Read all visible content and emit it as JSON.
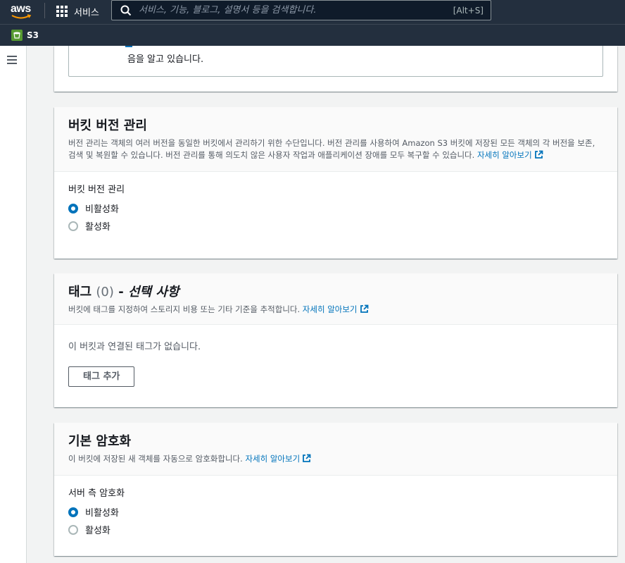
{
  "topnav": {
    "logo_text": "aws",
    "services_label": "서비스",
    "search_placeholder": "서비스, 기능, 블로그, 설명서 등을 검색합니다.",
    "search_shortcut": "[Alt+S]"
  },
  "subnav": {
    "service_label": "S3"
  },
  "top_panel": {
    "text": "음을 알고 있습니다."
  },
  "versioning": {
    "title": "버킷 버전 관리",
    "description": "버전 관리는 객체의 여러 버전을 동일한 버킷에서 관리하기 위한 수단입니다. 버전 관리를 사용하여 Amazon S3 버킷에 저장된 모든 객체의 각 버전을 보존, 검색 및 복원할 수 있습니다. 버전 관리를 통해 의도치 않은 사용자 작업과 애플리케이션 장애를 모두 복구할 수 있습니다.",
    "learn_more": "자세히 알아보기",
    "field_label": "버킷 버전 관리",
    "options": [
      {
        "label": "비활성화",
        "selected": true
      },
      {
        "label": "활성화",
        "selected": false
      }
    ]
  },
  "tags": {
    "title": "태그",
    "count": "(0)",
    "dash": "-",
    "optional": "선택 사항",
    "description": "버킷에 태그를 지정하여 스토리지 비용 또는 기타 기준을 추적합니다.",
    "learn_more": "자세히 알아보기",
    "empty_text": "이 버킷과 연결된 태그가 없습니다.",
    "add_button": "태그 추가"
  },
  "encryption": {
    "title": "기본 암호화",
    "description": "이 버킷에 저장된 새 객체를 자동으로 암호화합니다.",
    "learn_more": "자세히 알아보기",
    "field_label": "서버 측 암호화",
    "options": [
      {
        "label": "비활성화",
        "selected": true
      },
      {
        "label": "활성화",
        "selected": false
      }
    ]
  },
  "colors": {
    "nav_bg": "#232f3e",
    "link": "#0073bb",
    "aws_orange": "#ff9900",
    "s3_green": "#569a31"
  }
}
